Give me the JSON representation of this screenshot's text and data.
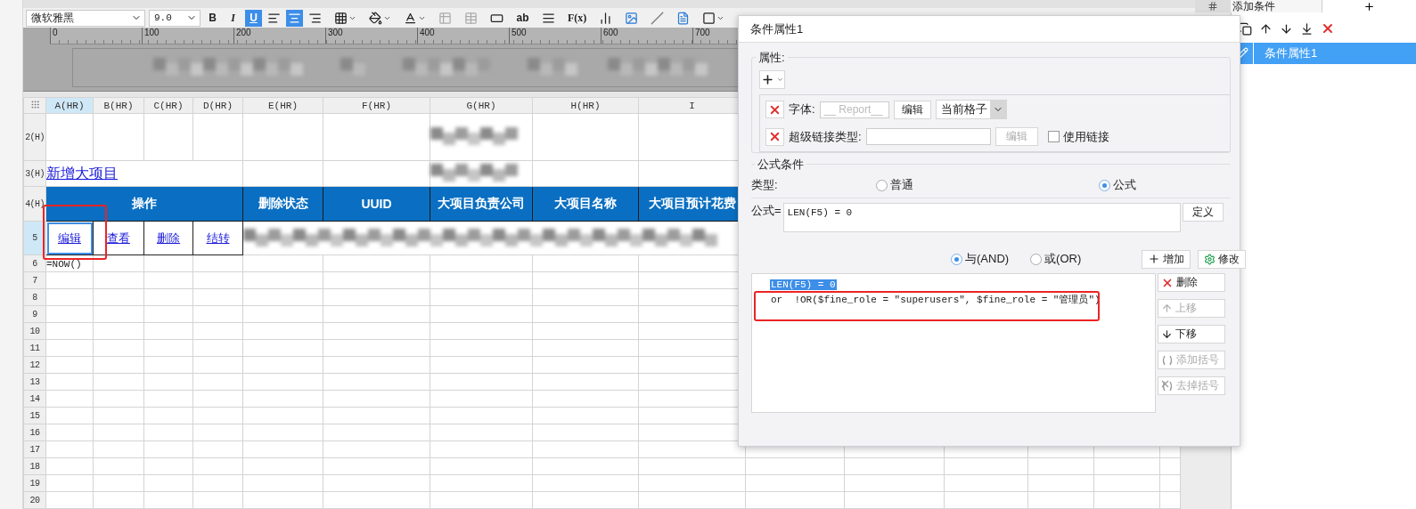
{
  "toolbar": {
    "font": "微软雅黑",
    "size": "9.0",
    "styles": [
      {
        "label": "B",
        "kind": "bold",
        "selected": false
      },
      {
        "label": "I",
        "kind": "italic",
        "selected": false
      },
      {
        "label": "U",
        "kind": "underline",
        "selected": true
      }
    ],
    "align": [
      {
        "kind": "left",
        "selected": false
      },
      {
        "kind": "center",
        "selected": true
      },
      {
        "kind": "right",
        "selected": false
      }
    ],
    "tools": [
      {
        "kind": "border"
      },
      {
        "kind": "fill"
      },
      {
        "kind": "fontcolor"
      },
      {
        "kind": "merge",
        "disabled": true
      },
      {
        "kind": "unmerge",
        "disabled": true
      },
      {
        "kind": "textfield"
      },
      {
        "kind": "text",
        "label": "ab"
      },
      {
        "kind": "paragraph"
      },
      {
        "kind": "formula",
        "label": "F(x)"
      },
      {
        "kind": "chart"
      },
      {
        "kind": "image"
      },
      {
        "kind": "slash"
      },
      {
        "kind": "report"
      },
      {
        "kind": "frame"
      }
    ]
  },
  "ruler": [
    "0",
    "100",
    "200",
    "300",
    "400",
    "500",
    "600",
    "700"
  ],
  "sheet": {
    "columns": [
      {
        "label": "A(HR)",
        "selected": true
      },
      {
        "label": "B(HR)",
        "selected": false
      },
      {
        "label": "C(HR)",
        "selected": false
      },
      {
        "label": "D(HR)",
        "selected": false
      },
      {
        "label": "E(HR)",
        "selected": false
      },
      {
        "label": "F(HR)",
        "selected": false
      },
      {
        "label": "G(HR)",
        "selected": false
      },
      {
        "label": "H(HR)",
        "selected": false
      },
      {
        "label": "I",
        "selected": false
      }
    ],
    "rows": [
      {
        "label": "2(H)",
        "kind": "blank",
        "blurred": true
      },
      {
        "label": "3(H)",
        "kind": "link",
        "text": "新增大项目",
        "blurred": true
      },
      {
        "label": "4(H)",
        "kind": "header",
        "group": "操作",
        "cells": [
          "删除状态",
          "UUID",
          "大项目负责公司",
          "大项目名称",
          "大项目预计花费"
        ]
      },
      {
        "label": "5",
        "kind": "actions",
        "blurred": true,
        "links": [
          {
            "text": "编辑",
            "selected": true,
            "annotated": true
          },
          {
            "text": "查看",
            "selected": false,
            "annotated": false
          },
          {
            "text": "删除",
            "selected": false,
            "annotated": false
          },
          {
            "text": "结转",
            "selected": false,
            "annotated": false
          }
        ]
      },
      {
        "label": "6",
        "kind": "formula",
        "text": "=NOW()"
      },
      {
        "label": "7",
        "kind": "blank"
      },
      {
        "label": "8",
        "kind": "blank"
      },
      {
        "label": "9",
        "kind": "blank"
      },
      {
        "label": "10",
        "kind": "blank"
      },
      {
        "label": "11",
        "kind": "blank"
      },
      {
        "label": "12",
        "kind": "blank"
      },
      {
        "label": "13",
        "kind": "blank"
      },
      {
        "label": "14",
        "kind": "blank"
      },
      {
        "label": "15",
        "kind": "blank"
      },
      {
        "label": "16",
        "kind": "blank"
      },
      {
        "label": "17",
        "kind": "blank"
      },
      {
        "label": "18",
        "kind": "blank"
      },
      {
        "label": "19",
        "kind": "blank"
      },
      {
        "label": "20",
        "kind": "blank"
      }
    ]
  },
  "dialog": {
    "title": "条件属性1",
    "properties": {
      "title": "属性:",
      "rows": [
        {
          "label": "字体:",
          "value": "__ Report__",
          "button": {
            "label": "编辑",
            "disabled": false
          },
          "select": "当前格子"
        },
        {
          "label": "超级链接类型:",
          "value": "",
          "button": {
            "label": "编辑",
            "disabled": true
          },
          "checkbox": {
            "label": "使用链接",
            "checked": false
          }
        }
      ]
    },
    "formula": {
      "title": "公式条件",
      "type_label": "类型:",
      "types": [
        {
          "label": "普通",
          "selected": false
        },
        {
          "label": "公式",
          "selected": true
        }
      ],
      "formula_label": "公式=",
      "formula_value": "LEN(F5) = 0",
      "define_button": "定义",
      "joins": [
        {
          "label": "与(AND)",
          "selected": true
        },
        {
          "label": "或(OR)",
          "selected": false
        }
      ],
      "add_button": "增加",
      "modify_button": "修改",
      "conditions": [
        {
          "text": "LEN(F5) = 0",
          "selected": true,
          "annotated": false
        },
        {
          "text": "or  !OR($fine_role = \"superusers\", $fine_role = \"管理员\")",
          "selected": false,
          "annotated": true
        }
      ],
      "actions": [
        {
          "kind": "delete",
          "label": "删除",
          "disabled": false
        },
        {
          "kind": "up",
          "label": "上移",
          "disabled": true
        },
        {
          "kind": "down",
          "label": "下移",
          "disabled": false
        },
        {
          "kind": "addparen",
          "label": "添加括号",
          "disabled": true
        },
        {
          "kind": "removeparen",
          "label": "去掉括号",
          "disabled": true
        }
      ]
    }
  },
  "side_panel": {
    "tab": "添加条件",
    "items": [
      {
        "label": "条件属性1",
        "selected": true
      }
    ]
  }
}
